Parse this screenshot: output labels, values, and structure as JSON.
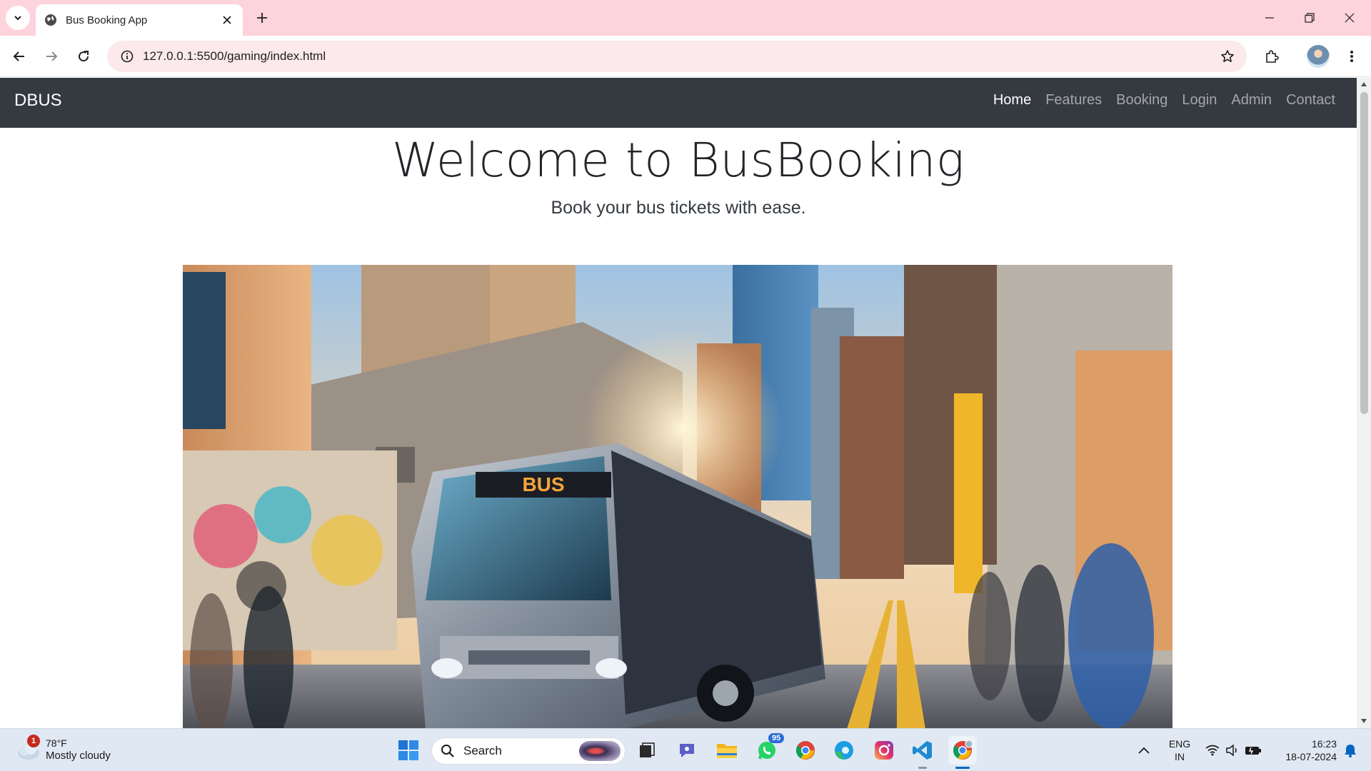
{
  "browser": {
    "tab_title": "Bus Booking App",
    "url": "127.0.0.1:5500/gaming/index.html"
  },
  "navbar": {
    "brand": "DBUS",
    "links": [
      {
        "label": "Home",
        "active": true
      },
      {
        "label": "Features",
        "active": false
      },
      {
        "label": "Booking",
        "active": false
      },
      {
        "label": "Login",
        "active": false
      },
      {
        "label": "Admin",
        "active": false
      },
      {
        "label": "Contact",
        "active": false
      }
    ],
    "bg_color": "#343a40"
  },
  "hero": {
    "title": "Welcome to BusBooking",
    "subtitle": "Book your bus tickets with ease.",
    "image": {
      "sign_text": "BUS"
    }
  },
  "taskbar": {
    "weather": {
      "temp": "78°F",
      "desc": "Mostly cloudy",
      "badge": "1"
    },
    "search_label": "Search",
    "whatsapp_badge": "95",
    "lang_top": "ENG",
    "lang_bottom": "IN",
    "time": "16:23",
    "date": "18-07-2024"
  },
  "colors": {
    "tabstrip": "#fdd3dc",
    "omnibox": "#fbe9ec",
    "taskbar": "#dfe8f3"
  }
}
